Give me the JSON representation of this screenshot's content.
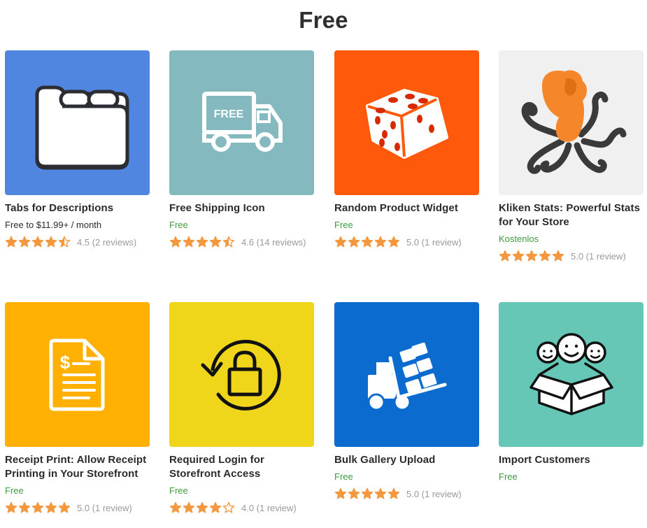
{
  "section": {
    "title": "Free"
  },
  "colors": {
    "star": "#f3983e",
    "star_empty": "#f3983e",
    "free": "#3f9b3f",
    "title": "#2f2f2f"
  },
  "products": [
    {
      "name": "Tabs for Descriptions",
      "price": "Free to $11.99+ / month",
      "price_is_free": false,
      "stars": 4.5,
      "rating_text": "4.5 (2 reviews)",
      "thumb_color": "#5085e0",
      "icon": "folder-tabs-icon"
    },
    {
      "name": "Free Shipping Icon",
      "price": "Free",
      "price_is_free": true,
      "stars": 4.5,
      "rating_text": "4.6 (14 reviews)",
      "thumb_color": "#84babf",
      "icon": "free-truck-icon",
      "icon_text": "FREE"
    },
    {
      "name": "Random Product Widget",
      "price": "Free",
      "price_is_free": true,
      "stars": 5,
      "rating_text": "5.0 (1 review)",
      "thumb_color": "#ff5a0c",
      "icon": "dice-icon"
    },
    {
      "name": "Kliken Stats: Powerful Stats for Your Store",
      "price": "Kostenlos",
      "price_is_free": true,
      "stars": 5,
      "rating_text": "5.0 (1 review)",
      "thumb_color": "#f0f0f1",
      "icon": "octopus-icon"
    },
    {
      "name": "Receipt Print: Allow Receipt Printing in Your Storefront",
      "price": "Free",
      "price_is_free": true,
      "stars": 5,
      "rating_text": "5.0 (1 review)",
      "thumb_color": "#ffb000",
      "icon": "receipt-icon"
    },
    {
      "name": "Required Login for Storefront Access",
      "price": "Free",
      "price_is_free": true,
      "stars": 4,
      "rating_text": "4.0 (1 review)",
      "thumb_color": "#f0d61b",
      "icon": "lock-refresh-icon"
    },
    {
      "name": "Bulk Gallery Upload",
      "price": "Free",
      "price_is_free": true,
      "stars": 5,
      "rating_text": "5.0 (1 review)",
      "thumb_color": "#0b6bce",
      "icon": "forklift-icon"
    },
    {
      "name": "Import Customers",
      "price": "Free",
      "price_is_free": true,
      "stars": null,
      "rating_text": "",
      "thumb_color": "#66c7b6",
      "icon": "box-people-icon"
    }
  ]
}
